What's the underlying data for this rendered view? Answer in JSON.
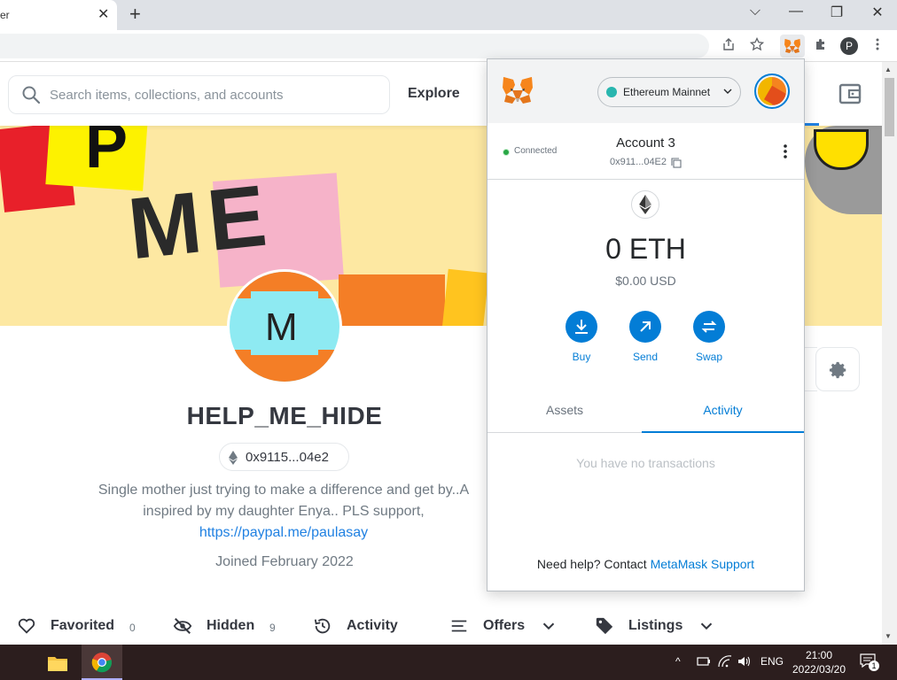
{
  "browser": {
    "tab_title": "er",
    "tab_close": "✕",
    "new_tab": "+",
    "win_min": "⌵",
    "win_min2": "—",
    "win_restore": "❐",
    "win_close": "✕",
    "profile_letter": "P"
  },
  "opensea": {
    "search_placeholder": "Search items, collections, and accounts",
    "explore": "Explore",
    "profile_name": "HELP_ME_HIDE",
    "address": "0x9115...04e2",
    "bio_line1": "Single mother just trying to make a difference and get by..A",
    "bio_line2": "inspired by my daughter Enya.. PLS support,",
    "bio_link": "https://paypal.me/paulasay",
    "joined": "Joined February 2022",
    "avatar_letters": "M",
    "banner_text1": "ME",
    "banner_text2": "P",
    "tabs": [
      {
        "label": "Favorited",
        "count": "0"
      },
      {
        "label": "Hidden",
        "count": "9"
      },
      {
        "label": "Activity"
      },
      {
        "label": "Offers"
      },
      {
        "label": "Listings"
      }
    ]
  },
  "metamask": {
    "network": "Ethereum Mainnet",
    "connected": "Connected",
    "account_name": "Account 3",
    "account_address": "0x911...04E2",
    "balance": "0 ETH",
    "fiat": "$0.00 USD",
    "actions": [
      {
        "label": "Buy"
      },
      {
        "label": "Send"
      },
      {
        "label": "Swap"
      }
    ],
    "tabs": [
      {
        "label": "Assets",
        "active": false
      },
      {
        "label": "Activity",
        "active": true
      }
    ],
    "empty": "You have no transactions",
    "help_prefix": "Need help? Contact",
    "help_link": "MetaMask Support",
    "accent": "#037dd6"
  },
  "taskbar": {
    "lang": "ENG",
    "time": "21:00",
    "date": "2022/03/20",
    "chevron": "^",
    "notif_count": "1"
  }
}
